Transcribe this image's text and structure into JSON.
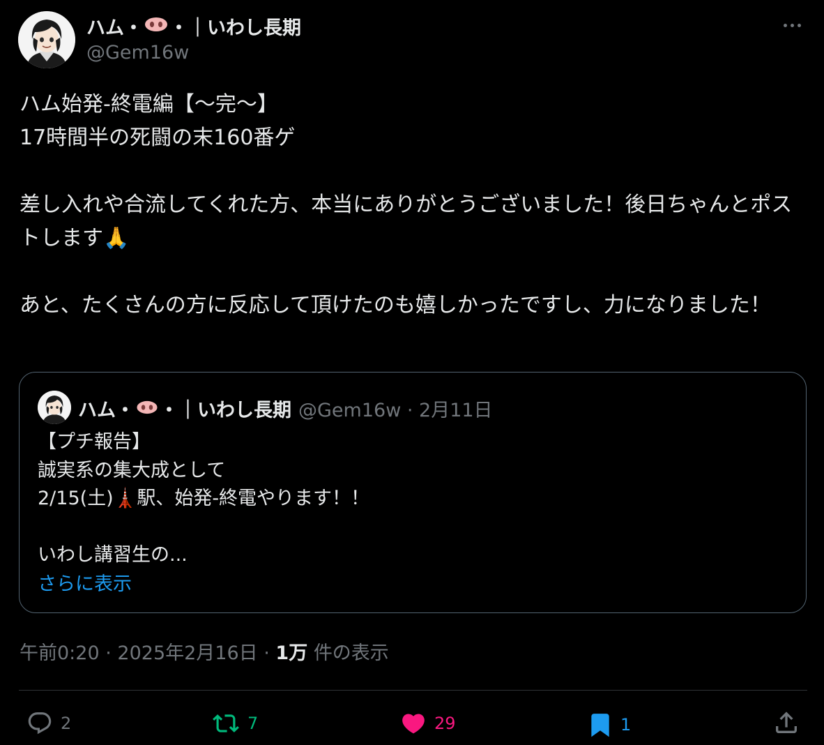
{
  "author": {
    "name_prefix": "ハム・",
    "name_suffix": "・｜いわし長期",
    "handle": "@Gem16w"
  },
  "tweet": {
    "text": "ハム始発-終電編【〜完〜】\n17時間半の死闘の末160番ゲ\n\n差し入れや合流してくれた方、本当にありがとうございました！後日ちゃんとポストします🙏\n\nあと、たくさんの方に反応して頂けたのも嬉しかったですし、力になりました！",
    "time": "午前0:20",
    "date": "2025年2月16日",
    "views_count": "1万",
    "views_label": "件の表示"
  },
  "quoted_tweet": {
    "name_prefix": "ハム・",
    "name_suffix": "・｜いわし長期",
    "meta": "@Gem16w · 2月11日",
    "text": "【プチ報告】\n誠実系の集大成として\n2/15(土)🗼駅、始発-終電やります！！\n\nいわし講習生の...",
    "show_more": "さらに表示"
  },
  "actions": {
    "reply_count": "2",
    "retweet_count": "7",
    "like_count": "29",
    "bookmark_count": "1"
  },
  "colors": {
    "background": "#000000",
    "text": "#e7e9ea",
    "muted": "#71767b",
    "link": "#1d9bf0",
    "retweet": "#00ba7c",
    "like": "#f91880",
    "bookmark": "#1d9bf0",
    "border": "#536471"
  },
  "icons": [
    "more-icon",
    "reply-icon",
    "retweet-icon",
    "like-icon",
    "bookmark-icon",
    "share-icon",
    "pig-nose-icon"
  ]
}
